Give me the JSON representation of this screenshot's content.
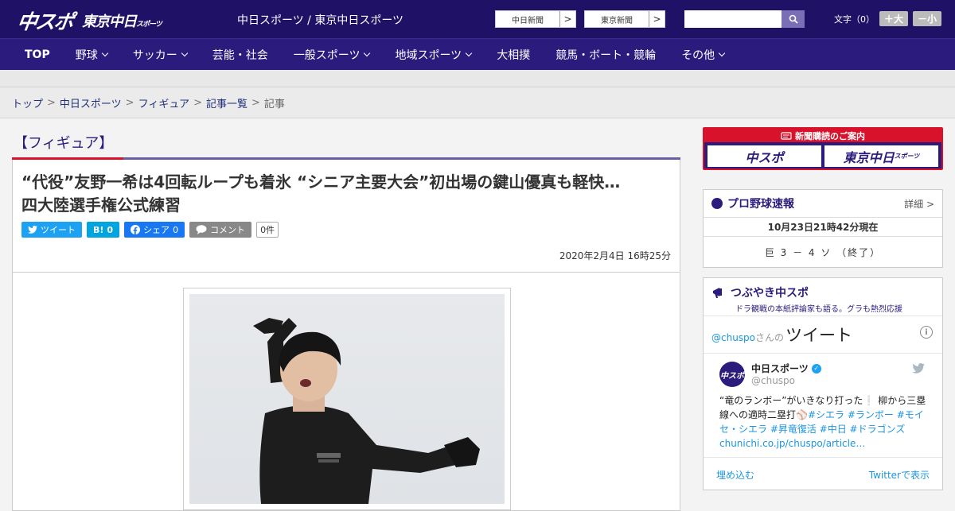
{
  "header": {
    "logo_chuspo": "中スポ",
    "logo_tokyo": "東京中日",
    "logo_tokyo_small": "スポーツ",
    "site_links": "中日スポーツ / 東京中日スポーツ",
    "newspaper_links": [
      "中日新聞",
      "東京新聞"
    ],
    "font_label": "文字（0）",
    "font_plus": "＋大",
    "font_minus": "－小"
  },
  "nav": [
    {
      "label": "TOP",
      "dropdown": false
    },
    {
      "label": "野球",
      "dropdown": true
    },
    {
      "label": "サッカー",
      "dropdown": true
    },
    {
      "label": "芸能・社会",
      "dropdown": false
    },
    {
      "label": "一般スポーツ",
      "dropdown": true
    },
    {
      "label": "地域スポーツ",
      "dropdown": true
    },
    {
      "label": "大相撲",
      "dropdown": false
    },
    {
      "label": "競馬・ボート・競輪",
      "dropdown": false
    },
    {
      "label": "その他",
      "dropdown": true
    }
  ],
  "breadcrumb": [
    "トップ",
    "中日スポーツ",
    "フィギュア",
    "記事一覧",
    "記事"
  ],
  "article": {
    "category": "【フィギュア】",
    "headline_1": "“代役”友野一希は4回転ループも着氷 “シニア主要大会”初出場の鍵山優真も軽快…",
    "headline_2": "四大陸選手権公式練習",
    "share_tweet": "ツイート",
    "share_hatena": "B!",
    "share_hatena_count": "0",
    "share_facebook": "シェア",
    "share_facebook_count": "0",
    "share_comment": "コメント",
    "comment_count": "0件",
    "date": "2020年2月4日 16時25分"
  },
  "sidebar": {
    "subscription_title": "新聞購読のご案内",
    "subscription_logo_1": "中スポ",
    "subscription_logo_2": "東京中日",
    "subscription_logo_2_small": "スポーツ",
    "baseball": {
      "title": "プロ野球速報",
      "detail": "詳細 >",
      "time": "10月23日21時42分現在",
      "score": "巨 3 － 4 ソ （終了）"
    },
    "twitter": {
      "title": "つぶやき中スポ",
      "subtitle": "ドラ観戦の本紙評論家も語る。グラも熱烈応援",
      "user_handle": "@chuspo",
      "user_suffix": "さんの",
      "user_tweet_label": "ツイート",
      "info": "i",
      "account_name": "中日スポーツ",
      "account_handle": "@chuspo",
      "avatar": "中スポ",
      "tweet_text_plain": "“竜のランボー”がいきなり打った❕ 柳から三塁線への適時二塁打⚾",
      "tweet_tags": "#シエラ #ランボー #モイセ・シエラ #昇竜復活 #中日 #ドラゴンズ",
      "tweet_link": "chunichi.co.jp/chuspo/article…",
      "embed_label": "埋め込む",
      "view_label": "Twitterで表示"
    }
  }
}
